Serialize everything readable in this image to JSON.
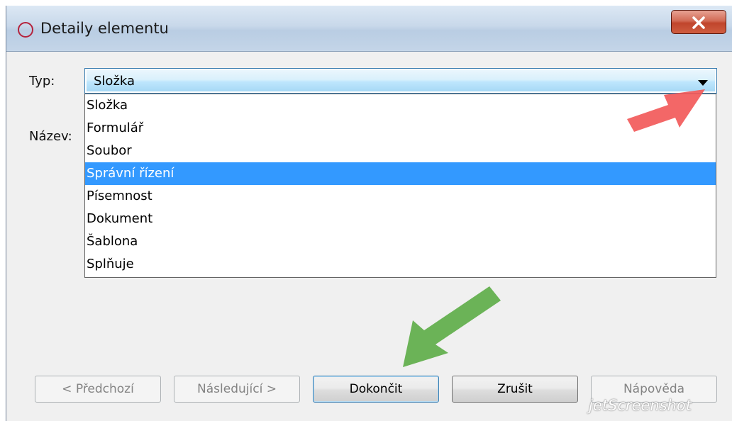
{
  "window": {
    "title": "Detaily elementu",
    "close_label": "X"
  },
  "form": {
    "type_label": "Typ:",
    "type_value": "Složka",
    "name_label": "Název:"
  },
  "dropdown": {
    "items": [
      {
        "label": "Složka",
        "selected": false
      },
      {
        "label": "Formulář",
        "selected": false
      },
      {
        "label": "Soubor",
        "selected": false
      },
      {
        "label": "Správní řízení",
        "selected": true
      },
      {
        "label": "Písemnost",
        "selected": false
      },
      {
        "label": "Dokument",
        "selected": false
      },
      {
        "label": "Šablona",
        "selected": false
      },
      {
        "label": "Splňuje",
        "selected": false
      }
    ]
  },
  "buttons": {
    "previous": "< Předchozí",
    "next": "Následující >",
    "finish": "Dokončit",
    "cancel": "Zrušit",
    "help": "Nápověda"
  },
  "watermark": "jetScreenshot",
  "colors": {
    "selection": "#3399ff",
    "red_arrow": "#f25a5a",
    "green_arrow": "#5fae4a"
  }
}
